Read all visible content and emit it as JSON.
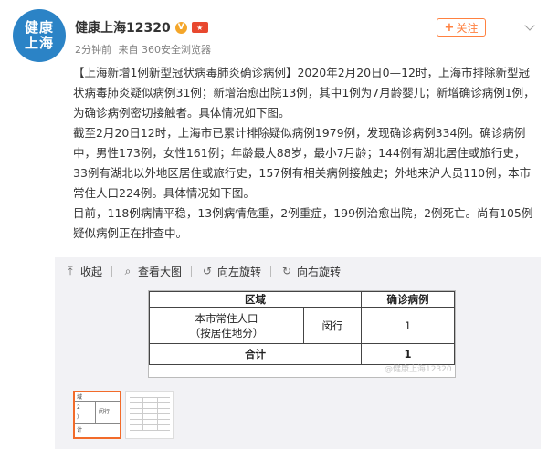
{
  "author": {
    "avatar_text": "健康上海",
    "name": "健康上海12320",
    "verified_icon": "V"
  },
  "meta": {
    "time": "2分钟前",
    "source": "来自 360安全浏览器"
  },
  "follow": {
    "label": "关注"
  },
  "post": {
    "paragraphs": [
      "【上海新增1例新型冠状病毒肺炎确诊病例】2020年2月20日0—12时，上海市排除新型冠状病毒肺炎疑似病例31例；新增治愈出院13例，其中1例为7月龄婴儿；新增确诊病例1例，为确诊病例密切接触者。具体情况如下图。",
      "截至2月20日12时，上海市已累计排除疑似病例1979例，发现确诊病例334例。确诊病例中，男性173例，女性161例；年龄最大88岁，最小7月龄；144例有湖北居住或旅行史，33例有湖北以外地区居住或旅行史，157例有相关病例接触史；外地来沪人员110例，本市常住人口224例。具体情况如下图。",
      "目前，118例病情平稳，13例病情危重，2例重症，199例治愈出院，2例死亡。尚有105例疑似病例正在排查中。"
    ]
  },
  "toolbar": {
    "collapse": "收起",
    "view_large": "查看大图",
    "rotate_left": "向左旋转",
    "rotate_right": "向右旋转"
  },
  "image_table": {
    "header_region": "区域",
    "header_cases": "确诊病例",
    "row_region_line1": "本市常住人口",
    "row_region_line2": "（按居住地分）",
    "row_district": "闵行",
    "row_cases": "1",
    "total_label": "合计",
    "total_cases": "1"
  },
  "thumb_text": {
    "t1": "域",
    "t2": "2",
    "t3": "）",
    "t4": "计",
    "t5": "闵行"
  },
  "colors": {
    "accent": "#ff8140",
    "avatar_bg": "#2b83c6",
    "media_bg": "#f2f2f5"
  }
}
